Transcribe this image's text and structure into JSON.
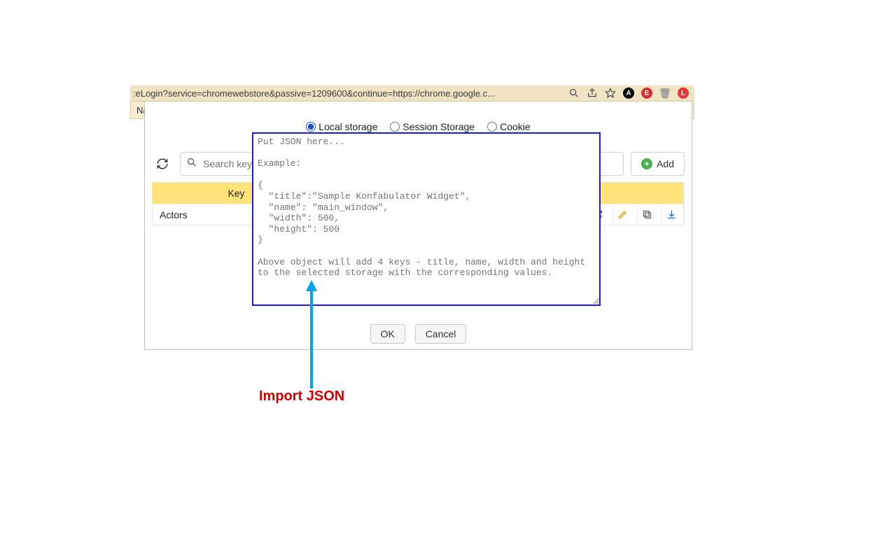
{
  "browser": {
    "url_fragment": ":eLogin?service=chromewebstore&passive=1209600&continue=https://chrome.google.c...",
    "bookmark_fragment": "Na"
  },
  "panel": {
    "search_placeholder": "Search key",
    "add_label": "Add",
    "columns": {
      "key": "Key"
    },
    "rows": [
      {
        "key": "Actors"
      }
    ]
  },
  "modal": {
    "radios": {
      "local": "Local storage",
      "session": "Session Storage",
      "cookie": "Cookie",
      "selected": "local"
    },
    "textarea_placeholder": "Put JSON here...\n\nExample:\n\n{\n  \"title\":\"Sample Konfabulator Widget\",\n  \"name\": \"main_window\",\n  \"width\": 500,\n  \"height\": 500\n}\n\nAbove object will add 4 keys - title, name, width and height to the selected storage with the corresponding values.",
    "ok": "OK",
    "cancel": "Cancel"
  },
  "annotation": {
    "label": "Import JSON"
  }
}
